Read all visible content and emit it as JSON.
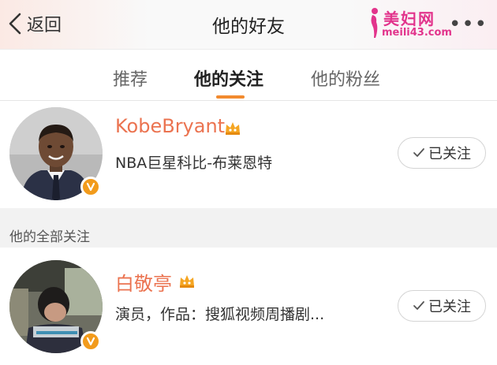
{
  "header": {
    "back_label": "返回",
    "title": "他的好友",
    "more_label": "•••",
    "logo": {
      "title": "美妇网",
      "url": "meili43.com"
    }
  },
  "tabs": [
    {
      "label": "推荐",
      "active": false
    },
    {
      "label": "他的关注",
      "active": true
    },
    {
      "label": "他的粉丝",
      "active": false
    }
  ],
  "featured": {
    "name": "KobeBryant",
    "description": "NBA巨星科比-布莱恩特",
    "follow_label": "已关注"
  },
  "section": {
    "label": "他的全部关注"
  },
  "following": [
    {
      "name": "白敬亭",
      "description": "演员，作品：搜狐视频周播剧...",
      "follow_label": "已关注"
    }
  ],
  "colors": {
    "accent": "#eb7350",
    "tab_indicator": "#f28a2e",
    "verified_badge": "#f29b1c",
    "watermark": "#e2348c"
  }
}
